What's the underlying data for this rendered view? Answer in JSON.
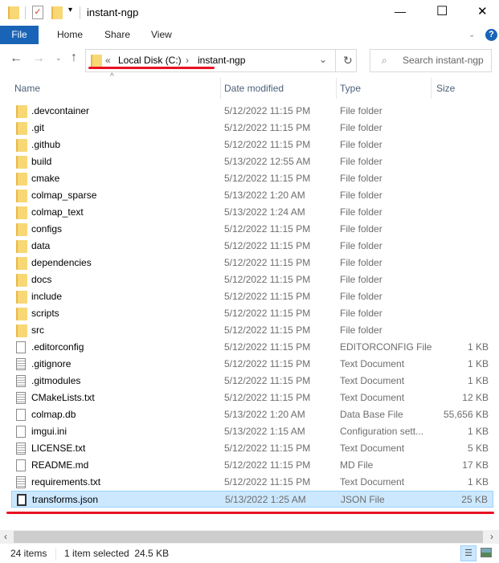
{
  "window": {
    "title": "instant-ngp",
    "minimize": "—",
    "maximize": "☐",
    "close": "✕"
  },
  "ribbon": {
    "tabs": [
      "File",
      "Home",
      "Share",
      "View"
    ],
    "help": "?"
  },
  "address": {
    "prefix": "«",
    "crumbs": [
      "Local Disk (C:)",
      "instant-ngp"
    ],
    "separator": "›"
  },
  "search": {
    "placeholder": "Search instant-ngp"
  },
  "columns": {
    "name": "Name",
    "date": "Date modified",
    "type": "Type",
    "size": "Size"
  },
  "files": [
    {
      "name": ".devcontainer",
      "date": "5/12/2022 11:15 PM",
      "type": "File folder",
      "size": "",
      "icon": "folder"
    },
    {
      "name": ".git",
      "date": "5/12/2022 11:15 PM",
      "type": "File folder",
      "size": "",
      "icon": "folder"
    },
    {
      "name": ".github",
      "date": "5/12/2022 11:15 PM",
      "type": "File folder",
      "size": "",
      "icon": "folder"
    },
    {
      "name": "build",
      "date": "5/13/2022 12:55 AM",
      "type": "File folder",
      "size": "",
      "icon": "folder"
    },
    {
      "name": "cmake",
      "date": "5/12/2022 11:15 PM",
      "type": "File folder",
      "size": "",
      "icon": "folder"
    },
    {
      "name": "colmap_sparse",
      "date": "5/13/2022 1:20 AM",
      "type": "File folder",
      "size": "",
      "icon": "folder"
    },
    {
      "name": "colmap_text",
      "date": "5/13/2022 1:24 AM",
      "type": "File folder",
      "size": "",
      "icon": "folder"
    },
    {
      "name": "configs",
      "date": "5/12/2022 11:15 PM",
      "type": "File folder",
      "size": "",
      "icon": "folder"
    },
    {
      "name": "data",
      "date": "5/12/2022 11:15 PM",
      "type": "File folder",
      "size": "",
      "icon": "folder"
    },
    {
      "name": "dependencies",
      "date": "5/12/2022 11:15 PM",
      "type": "File folder",
      "size": "",
      "icon": "folder"
    },
    {
      "name": "docs",
      "date": "5/12/2022 11:15 PM",
      "type": "File folder",
      "size": "",
      "icon": "folder"
    },
    {
      "name": "include",
      "date": "5/12/2022 11:15 PM",
      "type": "File folder",
      "size": "",
      "icon": "folder"
    },
    {
      "name": "scripts",
      "date": "5/12/2022 11:15 PM",
      "type": "File folder",
      "size": "",
      "icon": "folder"
    },
    {
      "name": "src",
      "date": "5/12/2022 11:15 PM",
      "type": "File folder",
      "size": "",
      "icon": "folder"
    },
    {
      "name": ".editorconfig",
      "date": "5/12/2022 11:15 PM",
      "type": "EDITORCONFIG File",
      "size": "1 KB",
      "icon": "file"
    },
    {
      "name": ".gitignore",
      "date": "5/12/2022 11:15 PM",
      "type": "Text Document",
      "size": "1 KB",
      "icon": "text"
    },
    {
      "name": ".gitmodules",
      "date": "5/12/2022 11:15 PM",
      "type": "Text Document",
      "size": "1 KB",
      "icon": "text"
    },
    {
      "name": "CMakeLists.txt",
      "date": "5/12/2022 11:15 PM",
      "type": "Text Document",
      "size": "12 KB",
      "icon": "text"
    },
    {
      "name": "colmap.db",
      "date": "5/13/2022 1:20 AM",
      "type": "Data Base File",
      "size": "55,656 KB",
      "icon": "database"
    },
    {
      "name": "imgui.ini",
      "date": "5/13/2022 1:15 AM",
      "type": "Configuration sett...",
      "size": "1 KB",
      "icon": "config"
    },
    {
      "name": "LICENSE.txt",
      "date": "5/12/2022 11:15 PM",
      "type": "Text Document",
      "size": "5 KB",
      "icon": "text"
    },
    {
      "name": "README.md",
      "date": "5/12/2022 11:15 PM",
      "type": "MD File",
      "size": "17 KB",
      "icon": "file"
    },
    {
      "name": "requirements.txt",
      "date": "5/12/2022 11:15 PM",
      "type": "Text Document",
      "size": "1 KB",
      "icon": "text"
    },
    {
      "name": "transforms.json",
      "date": "5/13/2022 1:25 AM",
      "type": "JSON File",
      "size": "25 KB",
      "icon": "json",
      "selected": true
    }
  ],
  "status": {
    "count": "24 items",
    "selection": "1 item selected  24.5 KB"
  },
  "colors": {
    "accent": "#1a64b8",
    "selection": "#cce8ff",
    "annotation": "#e81123"
  }
}
